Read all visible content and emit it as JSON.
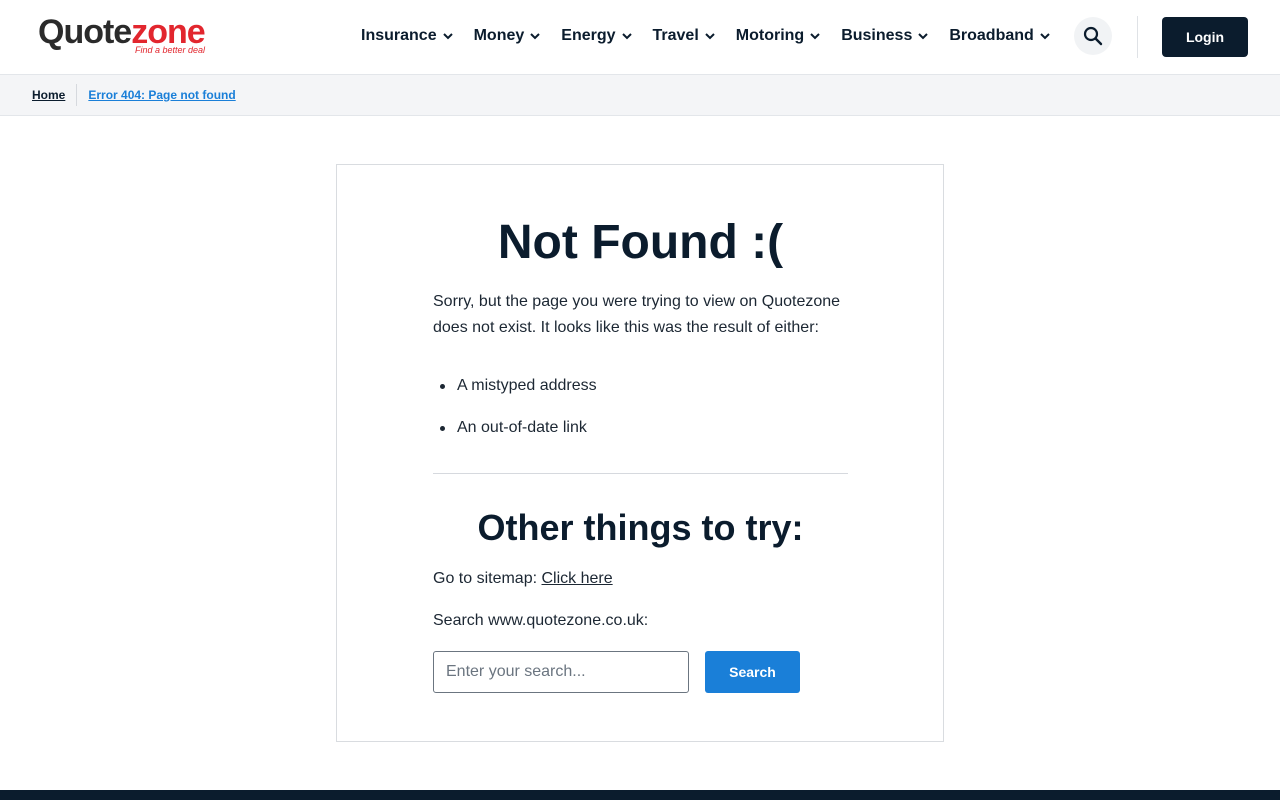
{
  "header": {
    "logo": {
      "part1": "Quote",
      "part2": "zone",
      "tagline": "Find a better deal"
    },
    "nav": [
      {
        "label": "Insurance",
        "icon": "chevron-down-icon"
      },
      {
        "label": "Money",
        "icon": "chevron-down-icon"
      },
      {
        "label": "Energy",
        "icon": "chevron-down-icon"
      },
      {
        "label": "Travel",
        "icon": "chevron-down-icon"
      },
      {
        "label": "Motoring",
        "icon": "chevron-down-icon"
      },
      {
        "label": "Business",
        "icon": "chevron-down-icon"
      },
      {
        "label": "Broadband",
        "icon": "chevron-down-icon"
      }
    ],
    "search_icon": "search-icon",
    "login_label": "Login"
  },
  "breadcrumb": {
    "home": "Home",
    "current": "Error 404: Page not found"
  },
  "main": {
    "title": "Not Found :(",
    "intro": "Sorry, but the page you were trying to view on Quotezone does not exist. It looks like this was the result of either:",
    "reasons": [
      "A mistyped address",
      "An out-of-date link"
    ],
    "subtitle": "Other things to try:",
    "sitemap_prefix": "Go to sitemap: ",
    "sitemap_link": "Click here",
    "search_label": "Search www.quotezone.co.uk:",
    "search_placeholder": "Enter your search...",
    "search_button": "Search"
  },
  "colors": {
    "brand_navy": "#0b1c2d",
    "brand_red": "#e2262e",
    "accent_blue": "#1a7fd8"
  }
}
